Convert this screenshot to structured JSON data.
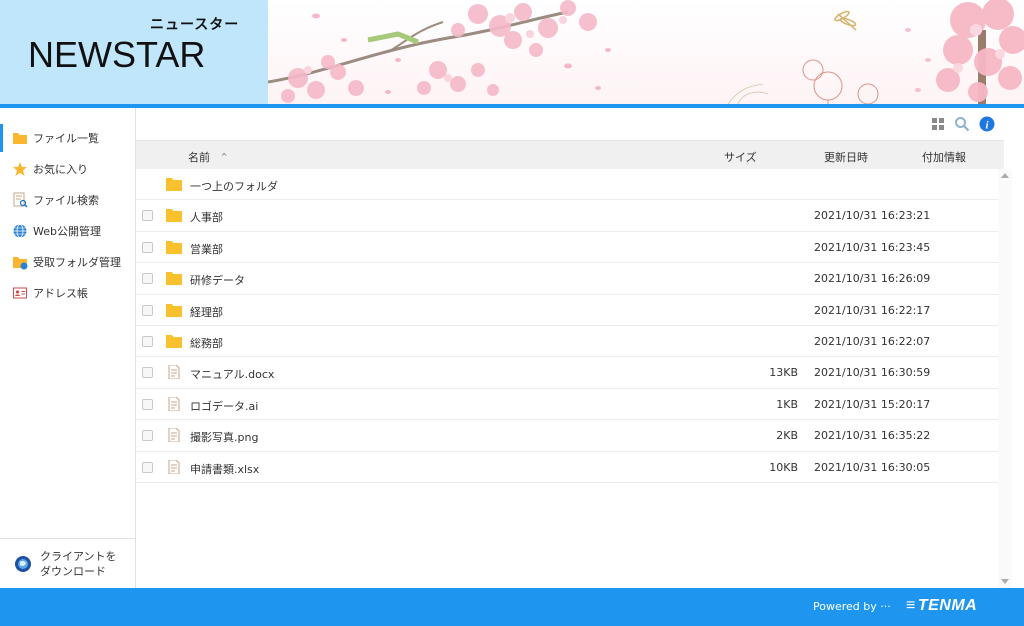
{
  "brand": {
    "kana": "ニュースター",
    "name": "NEWSTAR"
  },
  "sidebar": {
    "items": [
      {
        "label": "ファイル一覧",
        "icon": "folder-icon",
        "active": true
      },
      {
        "label": "お気に入り",
        "icon": "star-icon"
      },
      {
        "label": "ファイル検索",
        "icon": "file-search-icon"
      },
      {
        "label": "Web公開管理",
        "icon": "globe-icon"
      },
      {
        "label": "受取フォルダ管理",
        "icon": "receive-folder-icon"
      },
      {
        "label": "アドレス帳",
        "icon": "address-book-icon"
      }
    ],
    "download_line1": "クライアントを",
    "download_line2": "ダウンロード"
  },
  "columns": {
    "name": "名前",
    "size": "サイズ",
    "modified": "更新日時",
    "extra": "付加情報"
  },
  "files": [
    {
      "name": "一つ上のフォルダ",
      "type": "folder",
      "size": "",
      "modified": "",
      "parent": true
    },
    {
      "name": "人事部",
      "type": "folder",
      "size": "",
      "modified": "2021/10/31 16:23:21"
    },
    {
      "name": "営業部",
      "type": "folder",
      "size": "",
      "modified": "2021/10/31 16:23:45"
    },
    {
      "name": "研修データ",
      "type": "folder",
      "size": "",
      "modified": "2021/10/31 16:26:09"
    },
    {
      "name": "経理部",
      "type": "folder",
      "size": "",
      "modified": "2021/10/31 16:22:17"
    },
    {
      "name": "総務部",
      "type": "folder",
      "size": "",
      "modified": "2021/10/31 16:22:07"
    },
    {
      "name": "マニュアル.docx",
      "type": "file",
      "size": "13KB",
      "modified": "2021/10/31 16:30:59"
    },
    {
      "name": "ロゴデータ.ai",
      "type": "file",
      "size": "1KB",
      "modified": "2021/10/31 15:20:17"
    },
    {
      "name": "撮影写真.png",
      "type": "file",
      "size": "2KB",
      "modified": "2021/10/31 16:35:22"
    },
    {
      "name": "申請書類.xlsx",
      "type": "file",
      "size": "10KB",
      "modified": "2021/10/31 16:30:05"
    }
  ],
  "footer": {
    "powered": "Powered by ···",
    "company": "TENMA"
  },
  "colors": {
    "accent": "#1e96f0",
    "logo_bg": "#bfe6fb",
    "folder": "#f9c12e"
  }
}
